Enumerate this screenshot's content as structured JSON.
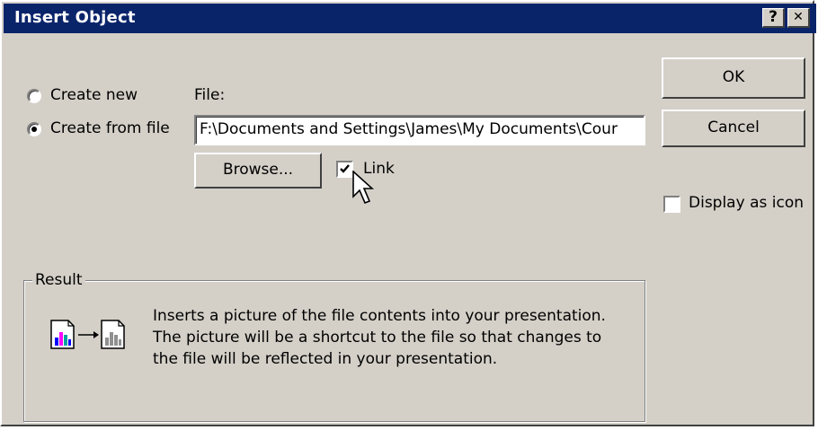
{
  "window": {
    "title": "Insert Object",
    "help_label": "?",
    "close_label": "✕"
  },
  "options": {
    "create_new_label": "Create new",
    "create_from_file_label": "Create from file",
    "selected": "create_from_file"
  },
  "file": {
    "label": "File:",
    "value": "F:\\Documents and Settings\\James\\My Documents\\Cour"
  },
  "buttons": {
    "browse_label": "Browse...",
    "ok_label": "OK",
    "cancel_label": "Cancel"
  },
  "link": {
    "label": "Link",
    "checked": true
  },
  "display_as_icon": {
    "label": "Display as icon",
    "checked": false
  },
  "result": {
    "label": "Result",
    "line1": "Inserts a picture of the file contents into your presentation.",
    "line2": "The picture will be a shortcut to the file so that changes to",
    "line3": "the file will be reflected in your presentation.",
    "icon": "linked-picture-icon"
  },
  "colors": {
    "titlebar": "#0a246a",
    "face": "#d4d0c8"
  }
}
